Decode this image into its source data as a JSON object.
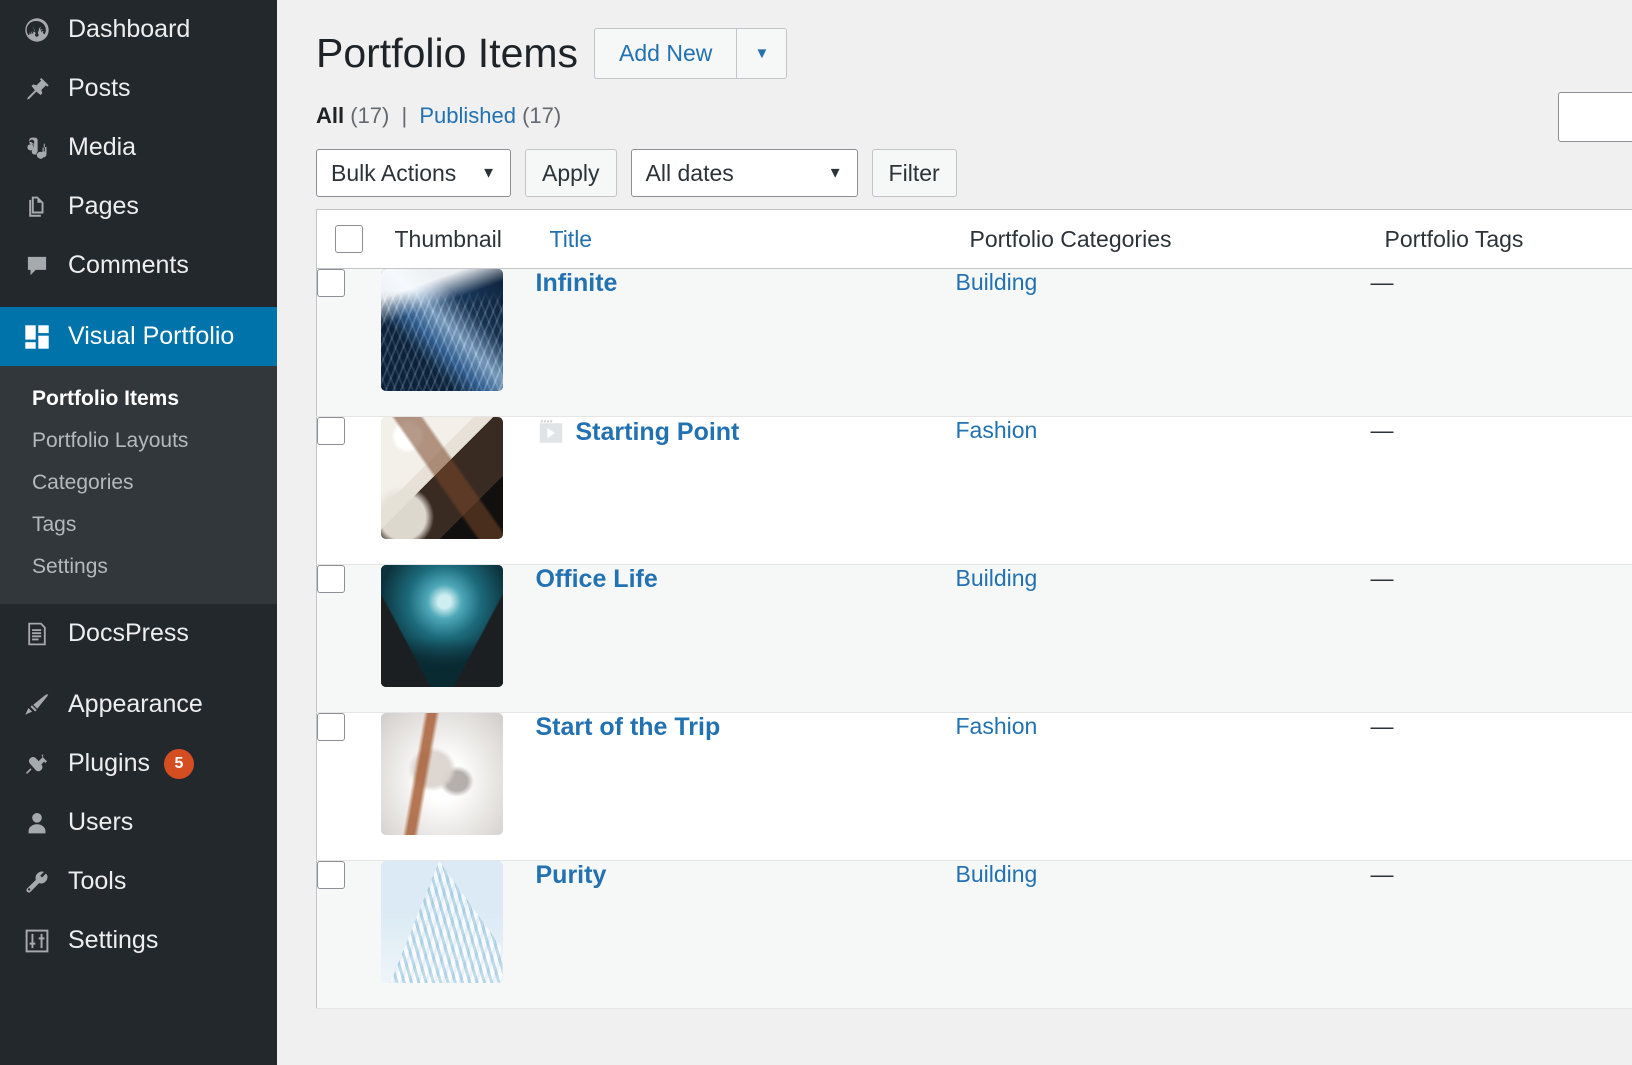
{
  "colors": {
    "sidebar_bg": "#23282d",
    "submenu_bg": "#32373c",
    "accent": "#0073aa",
    "link": "#2271b1",
    "badge": "#d54e21",
    "content_bg": "#f0f0f1"
  },
  "sidebar": {
    "items": [
      {
        "label": "Dashboard",
        "icon": "dashboard-icon",
        "current": false
      },
      {
        "label": "Posts",
        "icon": "pin-icon",
        "current": false
      },
      {
        "label": "Media",
        "icon": "media-icon",
        "current": false
      },
      {
        "label": "Pages",
        "icon": "pages-icon",
        "current": false
      },
      {
        "label": "Comments",
        "icon": "comments-icon",
        "current": false
      },
      {
        "label": "Visual Portfolio",
        "icon": "portfolio-grid-icon",
        "current": true
      },
      {
        "label": "DocsPress",
        "icon": "document-icon",
        "current": false
      },
      {
        "label": "Appearance",
        "icon": "paintbrush-icon",
        "current": false
      },
      {
        "label": "Plugins",
        "icon": "plug-icon",
        "current": false,
        "badge": "5"
      },
      {
        "label": "Users",
        "icon": "user-icon",
        "current": false
      },
      {
        "label": "Tools",
        "icon": "wrench-icon",
        "current": false
      },
      {
        "label": "Settings",
        "icon": "sliders-icon",
        "current": false
      }
    ],
    "submenu": [
      {
        "label": "Portfolio Items",
        "current": true
      },
      {
        "label": "Portfolio Layouts",
        "current": false
      },
      {
        "label": "Categories",
        "current": false
      },
      {
        "label": "Tags",
        "current": false
      },
      {
        "label": "Settings",
        "current": false
      }
    ]
  },
  "header": {
    "title": "Portfolio Items",
    "add_new_label": "Add New",
    "add_new_toggle_icon": "chevron-down-icon"
  },
  "views": {
    "all_label": "All",
    "all_count": "(17)",
    "divider": "|",
    "published_label": "Published",
    "published_count": "(17)"
  },
  "tablenav": {
    "bulk_actions_value": "Bulk Actions",
    "apply_label": "Apply",
    "dates_value": "All dates",
    "filter_label": "Filter",
    "search_value": ""
  },
  "table": {
    "columns": {
      "thumbnail": "Thumbnail",
      "title": "Title",
      "categories": "Portfolio Categories",
      "tags": "Portfolio Tags"
    },
    "rows": [
      {
        "title": "Infinite",
        "categories": "Building",
        "tags": "—",
        "thumb_class": "img-infinite",
        "format_icon": null
      },
      {
        "title": "Starting Point",
        "categories": "Fashion",
        "tags": "—",
        "thumb_class": "img-starting",
        "format_icon": "video-format-icon"
      },
      {
        "title": "Office Life",
        "categories": "Building",
        "tags": "—",
        "thumb_class": "img-office",
        "format_icon": null
      },
      {
        "title": "Start of the Trip",
        "categories": "Fashion",
        "tags": "—",
        "thumb_class": "img-trip",
        "format_icon": null
      },
      {
        "title": "Purity",
        "categories": "Building",
        "tags": "—",
        "thumb_class": "img-purity",
        "format_icon": null
      }
    ]
  }
}
